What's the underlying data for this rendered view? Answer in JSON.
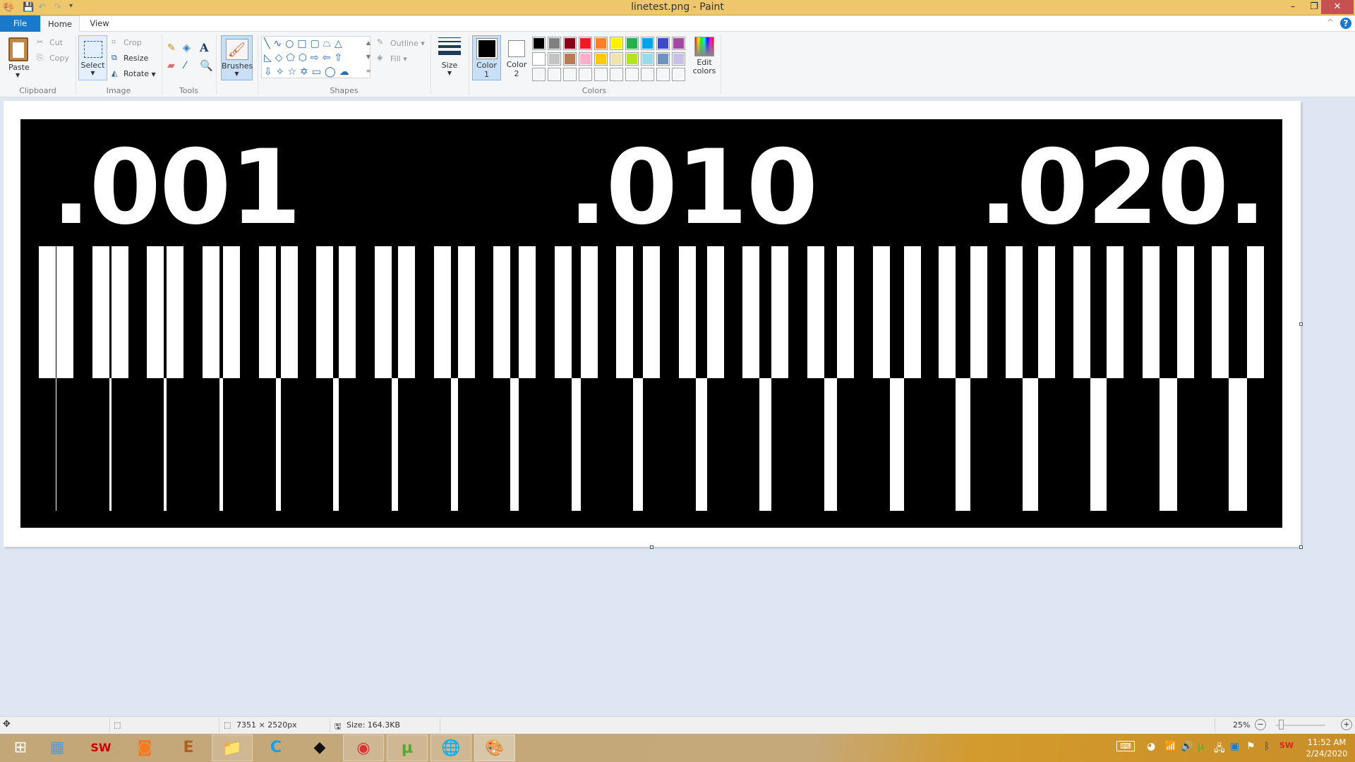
{
  "window": {
    "title": "linetest.png - Paint"
  },
  "tabs": [
    {
      "label": "File"
    },
    {
      "label": "Home"
    },
    {
      "label": "View"
    }
  ],
  "ribbon": {
    "clipboard": {
      "group": "Clipboard",
      "paste": "Paste",
      "cut": "Cut",
      "copy": "Copy"
    },
    "image": {
      "group": "Image",
      "select": "Select",
      "crop": "Crop",
      "resize": "Resize",
      "rotate": "Rotate"
    },
    "tools": {
      "group": "Tools"
    },
    "brushes": {
      "label": "Brushes"
    },
    "shapes": {
      "group": "Shapes",
      "outline": "Outline",
      "fill": "Fill"
    },
    "size": {
      "label": "Size"
    },
    "colors": {
      "group": "Colors",
      "color1": "Color",
      "color1_num": "1",
      "color2": "Color",
      "color2_num": "2",
      "color1_value": "#000000",
      "color2_value": "#ffffff",
      "edit": "Edit",
      "edit2": "colors",
      "palette_row1": [
        "#000000",
        "#7f7f7f",
        "#880015",
        "#ed1c24",
        "#ff7f27",
        "#fff200",
        "#22b14c",
        "#00a2e8",
        "#3f48cc",
        "#a349a4"
      ],
      "palette_row2": [
        "#ffffff",
        "#c3c3c3",
        "#b97a57",
        "#ffaec9",
        "#ffc90e",
        "#efe4b0",
        "#b5e61d",
        "#99d9ea",
        "#7092be",
        "#c8bfe7"
      ]
    }
  },
  "image_content": {
    "labels": [
      ".001",
      ".010",
      ".020."
    ],
    "line_pairs": 20
  },
  "statusbar": {
    "dimensions": "7351 × 2520px",
    "size": "Size: 164.3KB",
    "zoom": "25%",
    "zoom_level_percent": 25
  },
  "taskbar": {
    "apps": [
      "start",
      "calculator",
      "solidworks-2016",
      "foxit-pdf",
      "app-e",
      "file-explorer",
      "app-c",
      "inkscape",
      "chrome",
      "utorrent",
      "internet-download-manager",
      "paint"
    ],
    "clock_time": "11:52 AM",
    "clock_date": "2/24/2020"
  }
}
